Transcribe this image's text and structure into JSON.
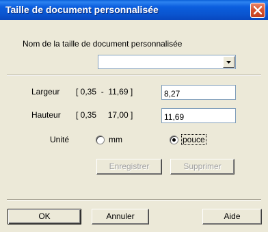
{
  "window": {
    "title": "Taille de document personnalisée"
  },
  "name_section": {
    "label": "Nom de la taille de document personnalisée",
    "combo_value": ""
  },
  "width_row": {
    "label": "Largeur",
    "range": "[ 0,35  -  11,69 ]",
    "value": "8,27"
  },
  "height_row": {
    "label": "Hauteur",
    "range": "[ 0,35     17,00 ]",
    "value": "11,69"
  },
  "unit_row": {
    "label": "Unité",
    "options": [
      {
        "label": "mm",
        "selected": false
      },
      {
        "label": "pouce",
        "selected": true
      }
    ]
  },
  "actions": {
    "save_label": "Enregistrer",
    "delete_label": "Supprimer"
  },
  "footer": {
    "ok_label": "OK",
    "cancel_label": "Annuler",
    "help_label": "Aide"
  },
  "colors": {
    "titlebar": "#0a55d0",
    "close_button": "#d6512c",
    "window_bg": "#ece9d8"
  },
  "icons": {
    "close": "close-icon",
    "dropdown": "chevron-down-icon"
  }
}
